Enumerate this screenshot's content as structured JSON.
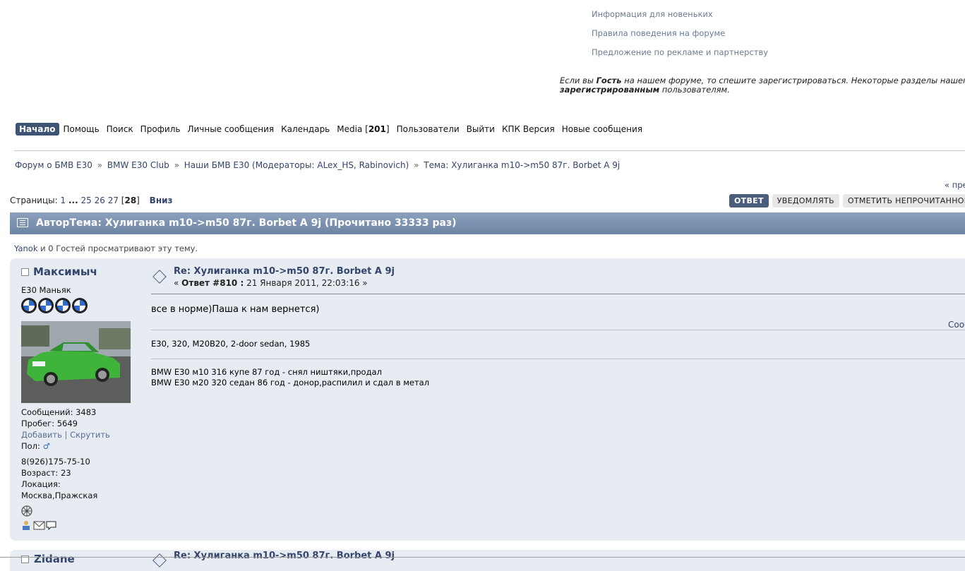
{
  "top_links": [
    "Информация для новеньких",
    "Правила поведения на форуме",
    "Предложение по рекламе и партнерству"
  ],
  "notice": {
    "p1": "Если вы ",
    "guest": "Гость",
    "p2": " на нашем форуме, то спешите зарегистрироваться. Некоторые разделы нашего фо",
    "registered": "зарегистрированным",
    "p3": " пользователям."
  },
  "menu": {
    "home": "Начало",
    "help": "Помощь",
    "search": "Поиск",
    "profile": "Профиль",
    "pm": "Личные сообщения",
    "calendar": "Календарь",
    "media": "Media [",
    "media_count": "201",
    "media_close": "]",
    "users": "Пользователи",
    "logout": "Выйти",
    "pda": "КПК Версия",
    "new": "Новые сообщения"
  },
  "breadcrumb": {
    "c1": "Форум о БМВ Е30",
    "c2": "BMW E30 Club",
    "c3": "Наши БМВ Е30 (Модераторы: ALex_HS, Rabinovich)",
    "c4": "Тема: Хулиганка m10->m50 87г. Borbet A 9j",
    "sep": "»"
  },
  "prev_link": "« пре",
  "pagination": {
    "label": "Страницы: ",
    "p1": "1",
    "dots": "...",
    "p25": "25",
    "p26": "26",
    "p27": "27",
    "current": "28",
    "down": "Вниз"
  },
  "buttons": {
    "reply": "ОТВЕТ",
    "notify": "УВЕДОМЛЯТЬ",
    "mark_unread": "ОТМЕТИТЬ НЕПРОЧИТАННОЙ"
  },
  "topic_header": "АвторТема: Хулиганка m10->m50 87г. Borbet A 9j  (Прочитано 33333 раз)",
  "viewing": {
    "user": "Yanok",
    "rest": " и 0 Гостей просматривают эту тему."
  },
  "post": {
    "author": "Максимыч",
    "rank": "E30 Маньяк",
    "posts": "Сообщений: 3483",
    "mileage": "Пробег: 5649",
    "add": "Добавить",
    "divider": " | ",
    "hide": "Скрутить",
    "gender_label": "Пол: ",
    "gender_icon": "♂",
    "phone": "8(926)175-75-10",
    "age": "Возраст: 23",
    "location_label": "Локация:",
    "location": "Москва,Пражская",
    "title": "Re: Хулиганка m10->m50 87г. Borbet A 9j",
    "meta_open": "« ",
    "reply_label": "Ответ #810 :",
    "date": " 21 Января 2011, 22:03:16 »",
    "text": "все в норме)Паша к нам вернется)",
    "right_link": "Сооб",
    "car": "E30, 320, M20B20, 2-door sedan, 1985",
    "sig1": "BMW E30 м10 316 купе 87 год - снял ништяки,продал",
    "sig2": "BMW E30 м20 320 седан 86 год - донор,распилил и сдал в метал"
  },
  "post2": {
    "author": "Zidane",
    "title": "Re: Хулиганка m10->m50 87г. Borbet A 9j"
  },
  "colors": {
    "accent": "#3d5475",
    "header_bar": "#7c91b0",
    "post_bg": "#e7ebf2",
    "link": "#34456b"
  }
}
